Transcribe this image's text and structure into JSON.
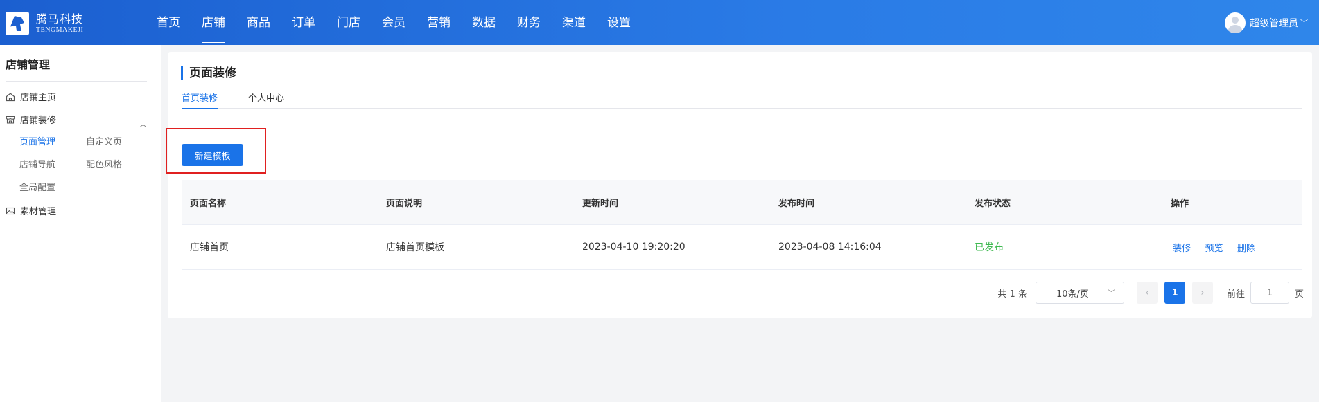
{
  "brand": {
    "name_cn": "腾马科技",
    "name_en": "TENGMAKEJI"
  },
  "nav": [
    {
      "label": "首页"
    },
    {
      "label": "店铺",
      "active": true
    },
    {
      "label": "商品"
    },
    {
      "label": "订单"
    },
    {
      "label": "门店"
    },
    {
      "label": "会员"
    },
    {
      "label": "营销"
    },
    {
      "label": "数据"
    },
    {
      "label": "财务"
    },
    {
      "label": "渠道"
    },
    {
      "label": "设置"
    }
  ],
  "user": {
    "name": "超级管理员",
    "icon": "chevron-down-icon"
  },
  "sidebar": {
    "title": "店铺管理",
    "items": [
      {
        "label": "店铺主页",
        "icon": "home-icon"
      },
      {
        "label": "店铺装修",
        "icon": "store-icon",
        "expanded": true
      },
      {
        "label": "素材管理",
        "icon": "image-icon"
      }
    ],
    "sub_items": [
      {
        "label": "页面管理",
        "active": true
      },
      {
        "label": "自定义页"
      },
      {
        "label": "店铺导航"
      },
      {
        "label": "配色风格"
      },
      {
        "label": "全局配置"
      }
    ]
  },
  "main": {
    "title": "页面装修",
    "tabs": [
      {
        "label": "首页装修",
        "active": true
      },
      {
        "label": "个人中心"
      }
    ],
    "new_button": "新建模板",
    "table": {
      "headers": [
        "页面名称",
        "页面说明",
        "更新时间",
        "发布时间",
        "发布状态",
        "操作"
      ],
      "rows": [
        {
          "name": "店铺首页",
          "desc": "店铺首页模板",
          "updated": "2023-04-10 19:20:20",
          "published": "2023-04-08 14:16:04",
          "status": "已发布",
          "actions": [
            "装修",
            "预览",
            "删除"
          ]
        }
      ]
    },
    "pagination": {
      "total": "共 1 条",
      "page_size": "10条/页",
      "prev": "‹",
      "current": "1",
      "next": "›",
      "goto_label": "前往",
      "goto_value": "1",
      "goto_unit": "页"
    }
  },
  "colors": {
    "primary": "#1a73e8",
    "success": "#3fb950",
    "highlight": "#e02020"
  }
}
